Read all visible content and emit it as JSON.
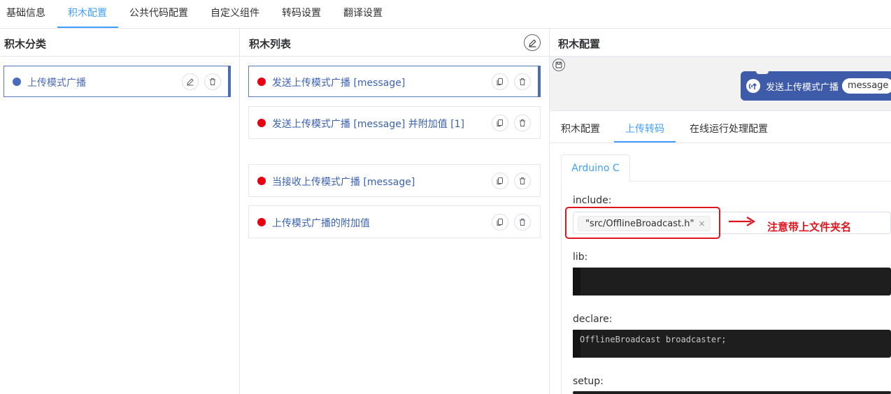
{
  "top_tabs": [
    {
      "label": "基础信息",
      "active": false
    },
    {
      "label": "积木配置",
      "active": true
    },
    {
      "label": "公共代码配置",
      "active": false
    },
    {
      "label": "自定义组件",
      "active": false
    },
    {
      "label": "转码设置",
      "active": false
    },
    {
      "label": "翻译设置",
      "active": false
    }
  ],
  "categories": {
    "title": "积木分类",
    "items": [
      {
        "label": "上传模式广播",
        "dot_color": "#4a6bb8",
        "selected": true
      }
    ]
  },
  "block_list": {
    "title": "积木列表",
    "items": [
      {
        "label": "发送上传模式广播 [message]",
        "dot_color": "#e60012",
        "selected": true
      },
      {
        "label": "发送上传模式广播 [message] 并附加值 [1]",
        "dot_color": "#e60012",
        "selected": false
      },
      {
        "label": "当接收上传模式广播 [message]",
        "dot_color": "#e60012",
        "selected": false
      },
      {
        "label": "上传模式广播的附加值",
        "dot_color": "#e60012",
        "selected": false
      }
    ]
  },
  "block_config": {
    "title": "积木配置",
    "preview": {
      "label": "发送上传模式广播",
      "param": "message",
      "color": "#3e5ba9"
    },
    "sub_tabs": [
      {
        "label": "积木配置",
        "active": false
      },
      {
        "label": "上传转码",
        "active": true
      },
      {
        "label": "在线运行处理配置",
        "active": false
      }
    ],
    "lang_tab": "Arduino C",
    "fields": {
      "include_label": "include:",
      "include_tags": [
        "\"src/OfflineBroadcast.h\""
      ],
      "lib_label": "lib:",
      "lib_code": "",
      "declare_label": "declare:",
      "declare_code": "OfflineBroadcast broadcaster;",
      "setup_label": "setup:"
    },
    "annotation": "注意带上文件夹名"
  },
  "colors": {
    "accent": "#409eff",
    "block": "#3e5ba9",
    "annotation_red": "#e0141e"
  }
}
